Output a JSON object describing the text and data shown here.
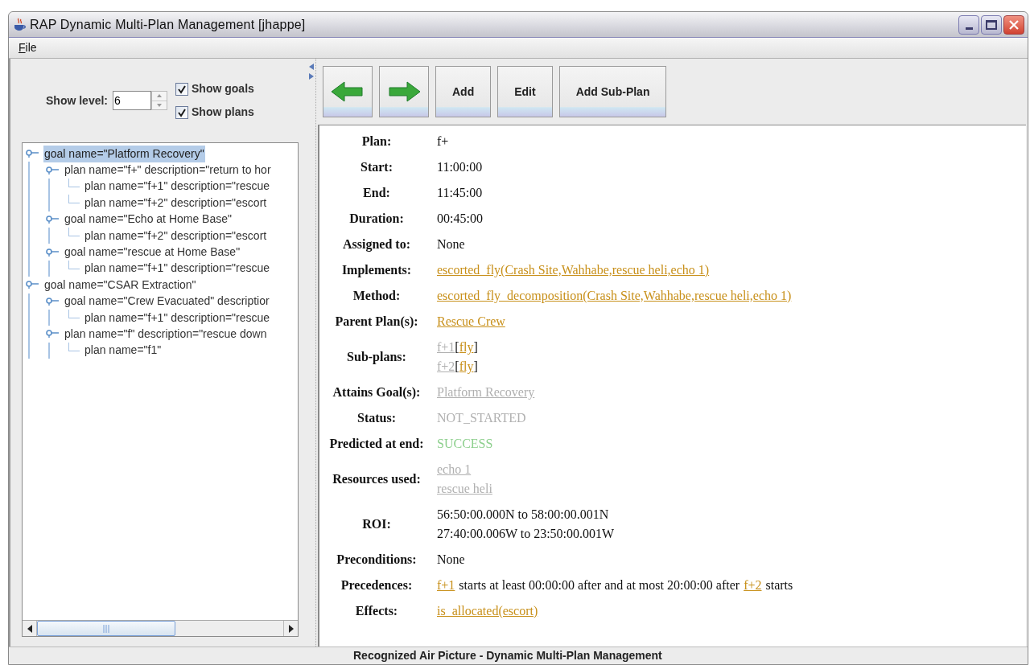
{
  "window": {
    "title": "RAP Dynamic Multi-Plan Management [jhappe]"
  },
  "menu": [
    {
      "label": "File"
    }
  ],
  "filters": {
    "level_label": "Show level:",
    "level_value": "6",
    "checkboxes": [
      {
        "label": "Show goals",
        "checked": true
      },
      {
        "label": "Show plans",
        "checked": true
      }
    ]
  },
  "tree": [
    {
      "label": "goal name=\"Platform Recovery\"",
      "selected": true,
      "children": [
        {
          "label": "plan name=\"f+\" description=\"return to hor",
          "selected": false,
          "children": [
            {
              "label": "plan name=\"f+1\" description=\"rescue",
              "selected": false
            },
            {
              "label": "plan name=\"f+2\" description=\"escort",
              "selected": false
            }
          ]
        },
        {
          "label": "goal name=\"Echo at Home Base\"",
          "selected": false,
          "children": [
            {
              "label": "plan name=\"f+2\" description=\"escort",
              "selected": false
            }
          ]
        },
        {
          "label": "goal name=\"rescue at Home Base\"",
          "selected": false,
          "children": [
            {
              "label": "plan name=\"f+1\" description=\"rescue",
              "selected": false
            }
          ]
        }
      ]
    },
    {
      "label": "goal name=\"CSAR Extraction\"",
      "selected": false,
      "children": [
        {
          "label": "goal name=\"Crew Evacuated\" descriptior",
          "selected": false,
          "children": [
            {
              "label": "plan name=\"f+1\" description=\"rescue",
              "selected": false
            }
          ]
        },
        {
          "label": "plan name=\"f\" description=\"rescue down",
          "selected": false,
          "children": [
            {
              "label": "plan name=\"f1\"",
              "selected": false
            }
          ]
        }
      ]
    }
  ],
  "toolbar": [
    {
      "kind": "back"
    },
    {
      "kind": "forward"
    },
    {
      "kind": "text",
      "label": "Add"
    },
    {
      "kind": "text",
      "label": "Edit"
    },
    {
      "kind": "text",
      "label": "Add Sub-Plan"
    }
  ],
  "details": [
    {
      "label": "Plan:",
      "lines": [
        [
          {
            "kind": "plain",
            "text": "f+"
          }
        ]
      ]
    },
    {
      "label": "Start:",
      "lines": [
        [
          {
            "kind": "plain",
            "text": "11:00:00"
          }
        ]
      ]
    },
    {
      "label": "End:",
      "lines": [
        [
          {
            "kind": "plain",
            "text": "11:45:00"
          }
        ]
      ]
    },
    {
      "label": "Duration:",
      "lines": [
        [
          {
            "kind": "plain",
            "text": "00:45:00"
          }
        ]
      ]
    },
    {
      "label": "Assigned to:",
      "lines": [
        [
          {
            "kind": "plain",
            "text": "None"
          }
        ]
      ]
    },
    {
      "label": "Implements:",
      "lines": [
        [
          {
            "kind": "link",
            "text": "escorted_fly(Crash Site,Wahhabe,rescue heli,echo 1)"
          }
        ]
      ]
    },
    {
      "label": "Method:",
      "lines": [
        [
          {
            "kind": "link",
            "text": "escorted_fly_decomposition(Crash Site,Wahhabe,rescue heli,echo 1)"
          }
        ]
      ]
    },
    {
      "label": "Parent Plan(s):",
      "lines": [
        [
          {
            "kind": "link",
            "text": "Rescue Crew"
          }
        ]
      ]
    },
    {
      "label": "Sub-plans:",
      "lines": [
        [
          {
            "kind": "faded_link",
            "text": "f+1"
          },
          {
            "kind": "plain",
            "text": "["
          },
          {
            "kind": "link",
            "text": "fly"
          },
          {
            "kind": "plain",
            "text": "]"
          }
        ],
        [
          {
            "kind": "faded_link",
            "text": "f+2"
          },
          {
            "kind": "plain",
            "text": "["
          },
          {
            "kind": "link",
            "text": "fly"
          },
          {
            "kind": "plain",
            "text": "]"
          }
        ]
      ]
    },
    {
      "label": "Attains Goal(s):",
      "lines": [
        [
          {
            "kind": "faded_link",
            "text": "Platform Recovery"
          }
        ]
      ]
    },
    {
      "label": "Status:",
      "lines": [
        [
          {
            "kind": "faded",
            "text": "NOT_STARTED"
          }
        ]
      ]
    },
    {
      "label": "Predicted at end:",
      "lines": [
        [
          {
            "kind": "success",
            "text": "SUCCESS"
          }
        ]
      ]
    },
    {
      "label": "Resources used:",
      "lines": [
        [
          {
            "kind": "faded_link",
            "text": "echo 1"
          }
        ],
        [
          {
            "kind": "faded_link",
            "text": "rescue heli"
          }
        ]
      ]
    },
    {
      "label": "ROI:",
      "lines": [
        [
          {
            "kind": "plain",
            "text": "56:50:00.000N to 58:00:00.001N"
          }
        ],
        [
          {
            "kind": "plain",
            "text": "27:40:00.006W to 23:50:00.001W"
          }
        ]
      ]
    },
    {
      "label": "Preconditions:",
      "lines": [
        [
          {
            "kind": "plain",
            "text": "None"
          }
        ]
      ]
    },
    {
      "label": "Precedences:",
      "lines": [
        [
          {
            "kind": "link",
            "text": "f+1"
          },
          {
            "kind": "plain",
            "text": "starts at least 00:00:00 after and at most 20:00:00 after"
          },
          {
            "kind": "link",
            "text": "f+2"
          },
          {
            "kind": "plain",
            "text": "starts"
          }
        ]
      ]
    },
    {
      "label": "Effects:",
      "lines": [
        [
          {
            "kind": "link",
            "text": "is_allocated(escort)"
          }
        ]
      ]
    }
  ],
  "status_bar": "Recognized Air Picture - Dynamic Multi-Plan Management"
}
